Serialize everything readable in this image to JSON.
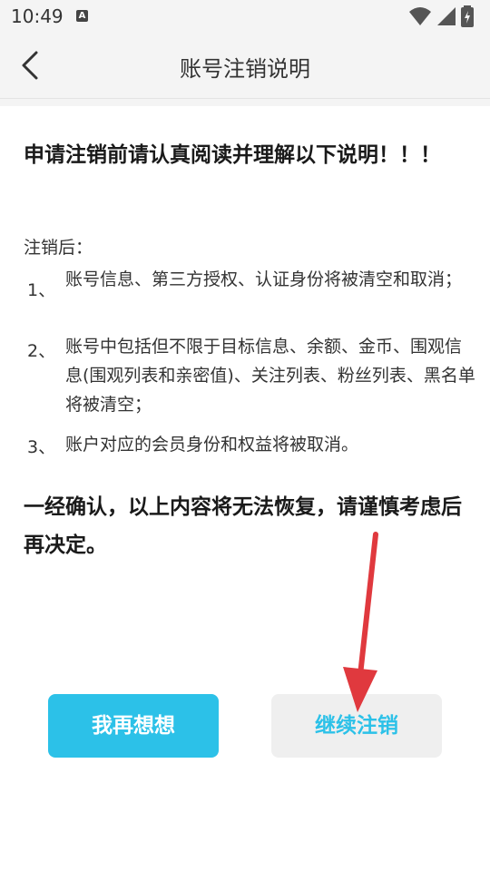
{
  "status_bar": {
    "time": "10:49",
    "notification_letter": "A"
  },
  "nav": {
    "title": "账号注销说明"
  },
  "content": {
    "warning_title": "申请注销前请认真阅读并理解以下说明！！！",
    "after_label": "注销后：",
    "items": [
      {
        "num": "1、",
        "text": "账号信息、第三方授权、认证身份将被清空和取消；"
      },
      {
        "num": "2、",
        "text": "账号中包括但不限于目标信息、余额、金币、围观信息(围观列表和亲密值)、关注列表、粉丝列表、黑名单将被清空；"
      },
      {
        "num": "3、",
        "text": "账户对应的会员身份和权益将被取消。"
      }
    ],
    "warning_bottom": "一经确认，以上内容将无法恢复，请谨慎考虑后再决定。"
  },
  "buttons": {
    "think_again": "我再想想",
    "continue_cancel": "继续注销"
  },
  "colors": {
    "accent": "#2cc1e8",
    "annotation_arrow": "#e0393e"
  }
}
